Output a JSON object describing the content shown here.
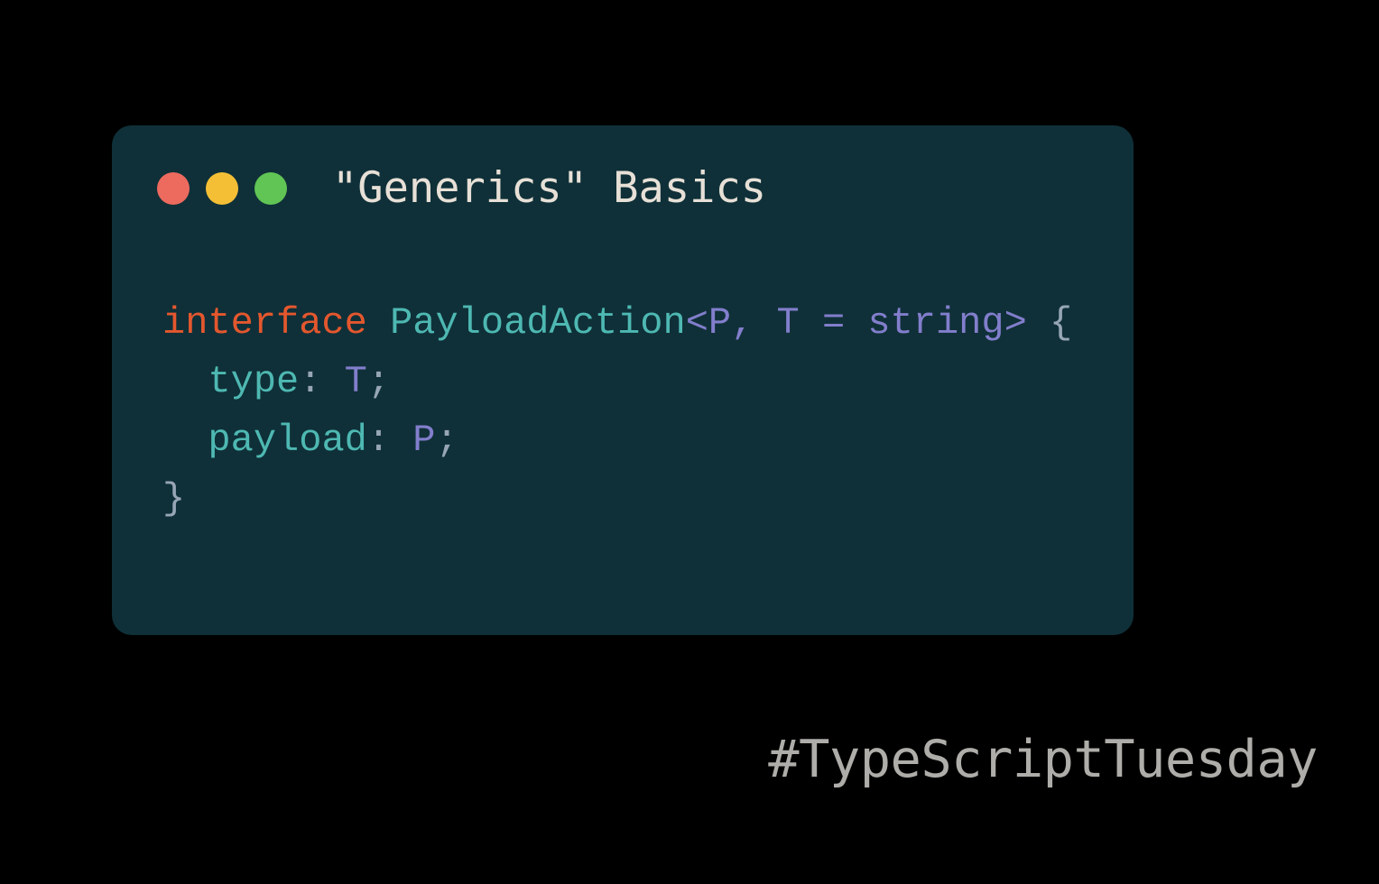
{
  "window": {
    "title": "\"Generics\" Basics"
  },
  "code": {
    "line1": {
      "keyword": "interface",
      "typeName": "PayloadAction",
      "generic": "<P, T = string>",
      "brace": " {"
    },
    "line2": {
      "indent": "  ",
      "prop": "type",
      "colon": ": ",
      "val": "T",
      "semi": ";"
    },
    "line3": {
      "indent": "  ",
      "prop": "payload",
      "colon": ": ",
      "val": "P",
      "semi": ";"
    },
    "line4": {
      "brace": "}"
    }
  },
  "hashtag": "#TypeScriptTuesday"
}
